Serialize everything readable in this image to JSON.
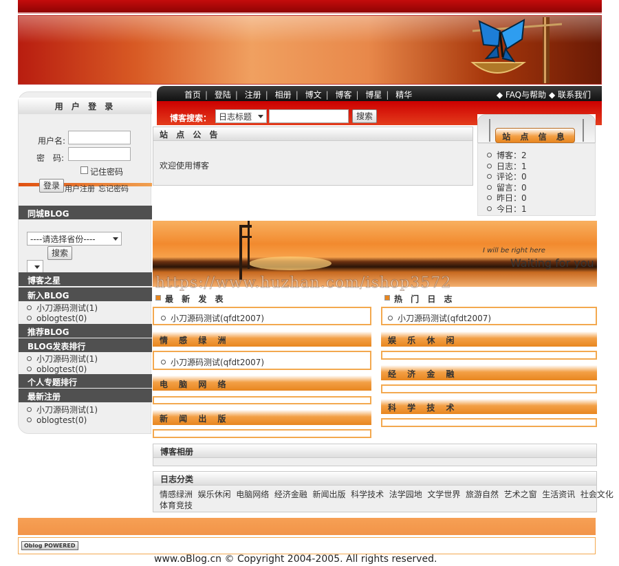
{
  "nav": {
    "links": [
      "首页",
      "登陆",
      "注册",
      "相册",
      "博文",
      "博客",
      "博星",
      "精华"
    ],
    "faq": "◆ FAQ与帮助",
    "contact": "◆ 联系我们"
  },
  "search": {
    "label": "博客搜索：",
    "select": "日志标题",
    "button": "搜索"
  },
  "login": {
    "title": "用 户 登 录",
    "username_label": "用户名:",
    "password_label": "密　码:",
    "remember": "记住密码",
    "login_button": "登录",
    "register_link": "用户注册",
    "forgot_link": "忘记密码"
  },
  "tongcheng": {
    "title": "同城BLOG",
    "province_select": "----请选择省份----",
    "search_button": "搜索"
  },
  "blog_star": {
    "title": "博客之星"
  },
  "new_blog": {
    "title": "新入BLOG",
    "items": [
      "小刀源码测试(1)",
      "oblogtest(0)"
    ]
  },
  "recommend": {
    "title": "推荐BLOG"
  },
  "ranking": {
    "title": "BLOG发表排行",
    "items": [
      "小刀源码测试(1)",
      "oblogtest(0)"
    ]
  },
  "topic_ranking": {
    "title": "个人专题排行"
  },
  "new_register": {
    "title": "最新注册",
    "items": [
      "小刀源码测试(1)",
      "oblogtest(0)"
    ]
  },
  "notice": {
    "title": "站 点 公 告",
    "text": "欢迎使用博客"
  },
  "site_info": {
    "title": "站 点 信 息",
    "items": [
      "博客：2",
      "日志：1",
      "评论：0",
      "留言：0",
      "昨日：0",
      "今日：1"
    ]
  },
  "banner2": {
    "line1": "I will be right here",
    "line2": "Waiting for you"
  },
  "watermark": "https://www.huzhan.com/ishop3572",
  "latest": {
    "title": "最 新 发 表",
    "items": [
      "小刀源码测试(qfdt2007)"
    ]
  },
  "hot": {
    "title": "热 门 日 志",
    "items": [
      "小刀源码测试(qfdt2007)"
    ]
  },
  "categories": [
    {
      "title": "情 感 绿 洲",
      "items": [
        "小刀源码测试(qfdt2007)"
      ]
    },
    {
      "title": "娱 乐 休 闲",
      "items": []
    },
    {
      "title": "电 脑 网 络",
      "items": []
    },
    {
      "title": "经 济 金 融",
      "items": []
    },
    {
      "title": "新 闻 出 版",
      "items": []
    },
    {
      "title": "科 学 技 术",
      "items": []
    }
  ],
  "album": {
    "title": "博客相册"
  },
  "log_cat": {
    "title": "日志分类",
    "line1": "情感绿洲  娱乐休闲  电脑网络  经济金融  新闻出版  科学技术  法学园地  文学世界  旅游自然  艺术之窗  生活资讯  社会文化",
    "line2": "体育竞技"
  },
  "footer": {
    "badge": "Oblog POWERED",
    "copyright": "www.oBlog.cn © Copyright 2004-2005. All rights reserved."
  }
}
